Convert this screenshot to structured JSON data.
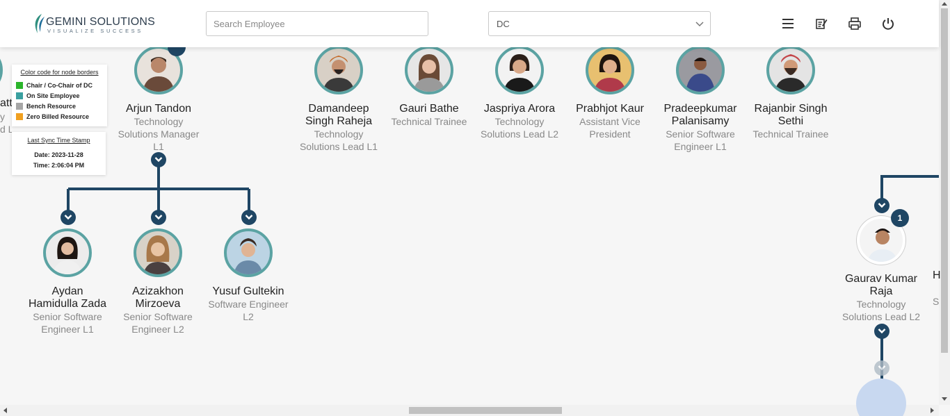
{
  "header": {
    "logo_title": "GEMINI SOLUTIONS",
    "logo_tagline": "VISUALIZE SUCCESS",
    "search_placeholder": "Search Employee",
    "filter_value": "DC",
    "icons": [
      "menu-icon",
      "edit-note-icon",
      "print-icon",
      "power-icon"
    ]
  },
  "legend": {
    "title": "Color code for node borders",
    "items": [
      {
        "label": "Chair / Co-Chair of DC",
        "color": "#2bb52b"
      },
      {
        "label": "On Site Employee",
        "color": "#3aa0a0"
      },
      {
        "label": "Bench Resource",
        "color": "#a6a6a6"
      },
      {
        "label": "Zero Billed Resource",
        "color": "#f0a020"
      }
    ]
  },
  "sync": {
    "title": "Last Sync Time Stamp",
    "date": "Date: 2023-11-28",
    "time": "Time: 2:06:04 PM"
  },
  "colors": {
    "node_border": "#5ba3a3",
    "connector": "#1f4664"
  },
  "top_row": [
    {
      "name": "Arjun Tandon",
      "role": "Technology Solutions Manager L1"
    },
    {
      "name": "Damandeep Singh Raheja",
      "role": "Technology Solutions Lead L1"
    },
    {
      "name": "Gauri Bathe",
      "role": "Technical Trainee"
    },
    {
      "name": "Jaspriya Arora",
      "role": "Technology Solutions Lead L2"
    },
    {
      "name": "Prabhjot Kaur",
      "role": "Assistant Vice President"
    },
    {
      "name": "Pradeepkumar Palanisamy",
      "role": "Senior Software Engineer L1"
    },
    {
      "name": "Rajanbir Singh Sethi",
      "role": "Technical Trainee"
    }
  ],
  "children": [
    {
      "name": "Aydan Hamidulla Zada",
      "role": "Senior Software Engineer L1"
    },
    {
      "name": "Azizakhon Mirzoeva",
      "role": "Senior Software Engineer L2"
    },
    {
      "name": "Yusuf Gultekin",
      "role": "Software Engineer L2"
    }
  ],
  "right_node": {
    "name": "Gaurav Kumar Raja",
    "role": "Technology Solutions Lead L2",
    "badge": "1"
  },
  "partial_left": {
    "name_fragment": "att",
    "role_fragment1": "y",
    "role_fragment2": "d L"
  },
  "partial_right": {
    "name_fragment": "H",
    "role_fragment": "S"
  }
}
